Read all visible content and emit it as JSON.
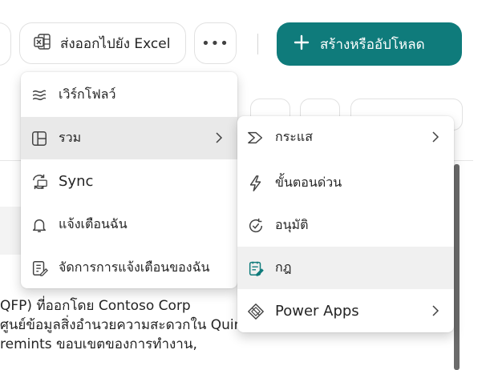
{
  "toolbar": {
    "export_excel_label": "ส่งออกไปยัง Excel",
    "more_label": "•••",
    "create_label": "สร้างหรืออัปโหลด"
  },
  "main_menu": {
    "items": [
      {
        "label": "เวิร์กโฟลว์",
        "icon": "workflow-icon"
      },
      {
        "label": "รวม",
        "icon": "integrate-icon",
        "has_submenu": true,
        "selected": true
      },
      {
        "label": "Sync",
        "icon": "sync-icon"
      },
      {
        "label": "แจ้งเตือนฉัน",
        "icon": "bell-icon"
      },
      {
        "label": "จัดการการแจ้งเตือนของฉัน",
        "icon": "manage-alerts-icon"
      }
    ]
  },
  "sub_menu": {
    "items": [
      {
        "label": "กระแส",
        "icon": "power-automate-icon",
        "has_submenu": true
      },
      {
        "label": "ขั้นตอนด่วน",
        "icon": "lightning-icon"
      },
      {
        "label": "อนุมัติ",
        "icon": "approval-icon"
      },
      {
        "label": "กฎ",
        "icon": "rules-icon",
        "hovered": true
      },
      {
        "label": "Power Apps",
        "icon": "power-apps-icon",
        "has_submenu": true
      }
    ]
  },
  "background_text": {
    "line1": "QFP) ที่ออกโดย Contoso Corp",
    "line2": "ศูนย์ข้อมูลสิ่งอำนวยความสะดวกใน Quincy,",
    "line3": "remints ขอบเขตของการทำงาน,"
  },
  "colors": {
    "accent": "#0f7b7b",
    "selected_bg": "#e9e9e9",
    "hover_bg": "#f0f0f0"
  }
}
